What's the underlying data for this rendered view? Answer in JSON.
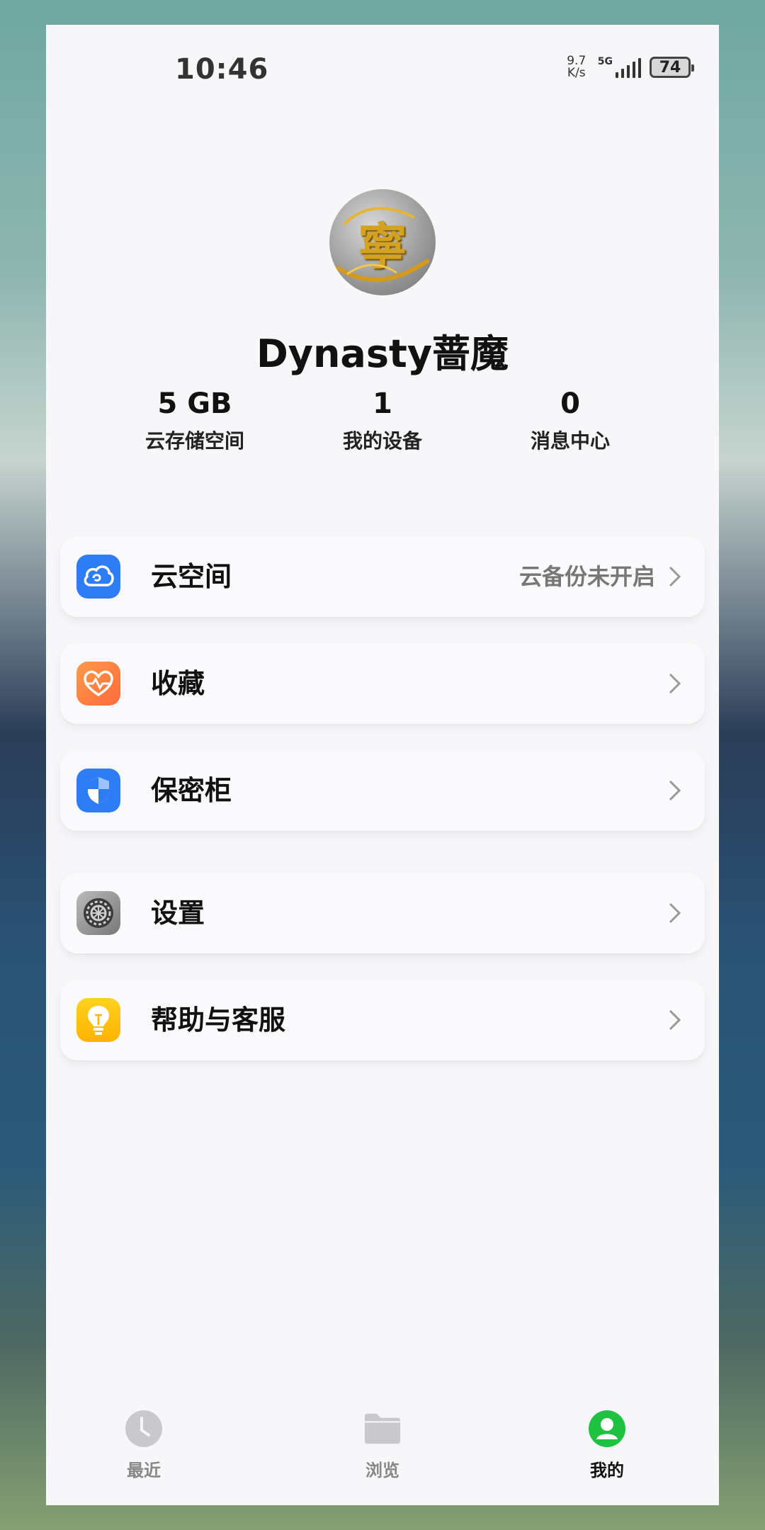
{
  "status_bar": {
    "time": "10:46",
    "net_speed_value": "9.7",
    "net_speed_unit": "K/s",
    "network": "5G",
    "battery": "74"
  },
  "profile": {
    "avatar_text": "寧",
    "username": "Dynasty蔷魔"
  },
  "stats": [
    {
      "value": "5 GB",
      "label": "云存储空间"
    },
    {
      "value": "1",
      "label": "我的设备"
    },
    {
      "value": "0",
      "label": "消息中心"
    }
  ],
  "menu": [
    {
      "label": "云空间",
      "sub": "云备份未开启",
      "icon": "cloud-icon",
      "color": "#2e7cf6"
    },
    {
      "label": "收藏",
      "sub": "",
      "icon": "heart-icon",
      "color": "#ff7a3c"
    },
    {
      "label": "保密柜",
      "sub": "",
      "icon": "shield-icon",
      "color": "#2e7cf6"
    },
    {
      "label": "设置",
      "sub": "",
      "icon": "gear-icon",
      "color": "#777777"
    },
    {
      "label": "帮助与客服",
      "sub": "",
      "icon": "lightbulb-icon",
      "color": "#ffc400"
    }
  ],
  "tabs": [
    {
      "label": "最近",
      "icon": "clock-icon",
      "active": false
    },
    {
      "label": "浏览",
      "icon": "folder-icon",
      "active": false
    },
    {
      "label": "我的",
      "icon": "person-icon",
      "active": true
    }
  ],
  "colors": {
    "accent_green": "#1ec140"
  }
}
